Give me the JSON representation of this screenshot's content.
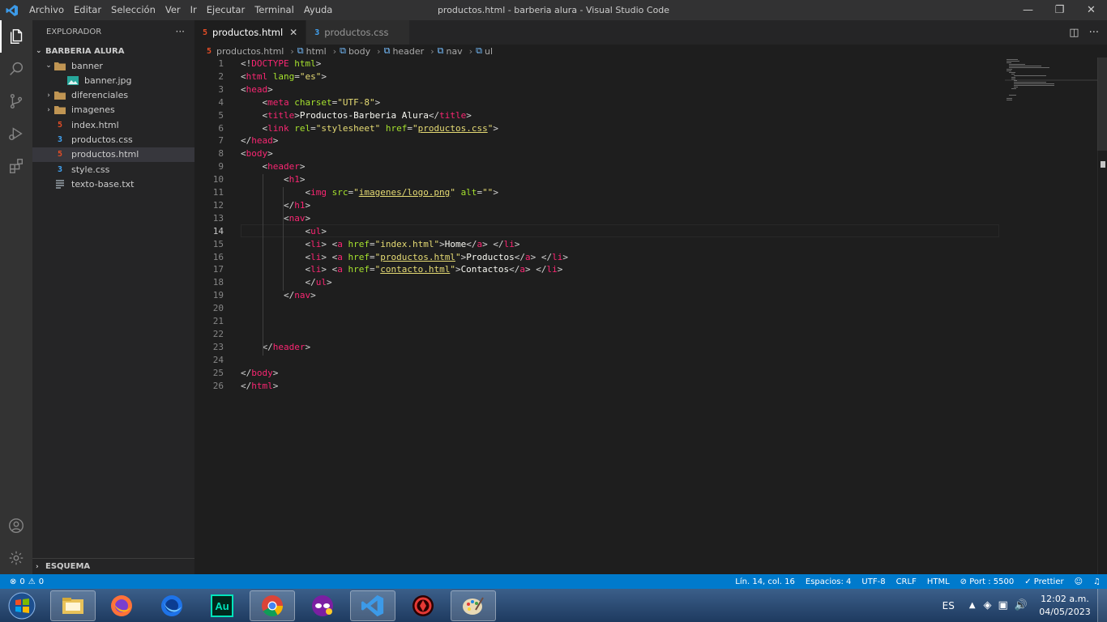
{
  "window": {
    "title": "productos.html - barberia alura - Visual Studio Code"
  },
  "menu": [
    "Archivo",
    "Editar",
    "Selección",
    "Ver",
    "Ir",
    "Ejecutar",
    "Terminal",
    "Ayuda"
  ],
  "sidebar": {
    "title": "EXPLORADOR",
    "more": "···",
    "workspace": "BARBERIA ALURA",
    "items": [
      {
        "label": "banner",
        "type": "folder-open",
        "depth": 1
      },
      {
        "label": "banner.jpg",
        "type": "image",
        "depth": 2
      },
      {
        "label": "diferenciales",
        "type": "folder",
        "depth": 1
      },
      {
        "label": "imagenes",
        "type": "folder",
        "depth": 1
      },
      {
        "label": "index.html",
        "type": "html",
        "depth": 1
      },
      {
        "label": "productos.css",
        "type": "css",
        "depth": 1
      },
      {
        "label": "productos.html",
        "type": "html",
        "depth": 1,
        "selected": true
      },
      {
        "label": "style.css",
        "type": "css",
        "depth": 1
      },
      {
        "label": "texto-base.txt",
        "type": "txt",
        "depth": 1
      }
    ],
    "outline": "ESQUEMA"
  },
  "tabs": [
    {
      "label": "productos.html",
      "type": "html",
      "active": true
    },
    {
      "label": "productos.css",
      "type": "css",
      "active": false
    }
  ],
  "breadcrumb": [
    "productos.html",
    "html",
    "body",
    "header",
    "nav",
    "ul"
  ],
  "editor": {
    "current_line": 14,
    "lines": [
      [
        [
          "t",
          "<!"
        ],
        [
          "tg",
          "DOCTYPE"
        ],
        [
          "t",
          " "
        ],
        [
          "at",
          "html"
        ],
        [
          "t",
          ">"
        ]
      ],
      [
        [
          "t",
          "<"
        ],
        [
          "tg",
          "html"
        ],
        [
          "t",
          " "
        ],
        [
          "at",
          "lang"
        ],
        [
          "t",
          "="
        ],
        [
          "st",
          "\"es\""
        ],
        [
          "t",
          ">"
        ]
      ],
      [
        [
          "t",
          "<"
        ],
        [
          "tg",
          "head"
        ],
        [
          "t",
          ">"
        ]
      ],
      [
        [
          "t",
          "    <"
        ],
        [
          "tg",
          "meta"
        ],
        [
          "t",
          " "
        ],
        [
          "at",
          "charset"
        ],
        [
          "t",
          "="
        ],
        [
          "st",
          "\"UTF-8\""
        ],
        [
          "t",
          ">"
        ]
      ],
      [
        [
          "t",
          "    <"
        ],
        [
          "tg",
          "title"
        ],
        [
          "t",
          ">"
        ],
        [
          "tx",
          "Productos-Barberia Alura"
        ],
        [
          "t",
          "</"
        ],
        [
          "tg",
          "title"
        ],
        [
          "t",
          ">"
        ]
      ],
      [
        [
          "t",
          "    <"
        ],
        [
          "tg",
          "link"
        ],
        [
          "t",
          " "
        ],
        [
          "at",
          "rel"
        ],
        [
          "t",
          "="
        ],
        [
          "st",
          "\"stylesheet\""
        ],
        [
          "t",
          " "
        ],
        [
          "at",
          "href"
        ],
        [
          "t",
          "="
        ],
        [
          "st",
          "\""
        ],
        [
          "stu",
          "productos.css"
        ],
        [
          "st",
          "\""
        ],
        [
          "t",
          ">"
        ]
      ],
      [
        [
          "t",
          "</"
        ],
        [
          "tg",
          "head"
        ],
        [
          "t",
          ">"
        ]
      ],
      [
        [
          "t",
          "<"
        ],
        [
          "tg",
          "body"
        ],
        [
          "t",
          ">"
        ]
      ],
      [
        [
          "t",
          "    <"
        ],
        [
          "tg",
          "header"
        ],
        [
          "t",
          ">"
        ]
      ],
      [
        [
          "t",
          "        <"
        ],
        [
          "tg",
          "h1"
        ],
        [
          "t",
          ">"
        ]
      ],
      [
        [
          "t",
          "            <"
        ],
        [
          "tg",
          "img"
        ],
        [
          "t",
          " "
        ],
        [
          "at",
          "src"
        ],
        [
          "t",
          "="
        ],
        [
          "st",
          "\""
        ],
        [
          "stu",
          "imagenes/logo.png"
        ],
        [
          "st",
          "\""
        ],
        [
          "t",
          " "
        ],
        [
          "at",
          "alt"
        ],
        [
          "t",
          "="
        ],
        [
          "st",
          "\"\""
        ],
        [
          "t",
          ">"
        ]
      ],
      [
        [
          "t",
          "        </"
        ],
        [
          "tg",
          "h1"
        ],
        [
          "t",
          ">"
        ]
      ],
      [
        [
          "t",
          "        <"
        ],
        [
          "tg",
          "nav"
        ],
        [
          "t",
          ">"
        ]
      ],
      [
        [
          "t",
          "            <"
        ],
        [
          "tg",
          "ul"
        ],
        [
          "t",
          ">"
        ]
      ],
      [
        [
          "t",
          "            <"
        ],
        [
          "tg",
          "li"
        ],
        [
          "t",
          "> <"
        ],
        [
          "tg",
          "a"
        ],
        [
          "t",
          " "
        ],
        [
          "at",
          "href"
        ],
        [
          "t",
          "="
        ],
        [
          "st",
          "\"index.html\""
        ],
        [
          "t",
          ">"
        ],
        [
          "tx",
          "Home"
        ],
        [
          "t",
          "</"
        ],
        [
          "tg",
          "a"
        ],
        [
          "t",
          "> </"
        ],
        [
          "tg",
          "li"
        ],
        [
          "t",
          ">"
        ]
      ],
      [
        [
          "t",
          "            <"
        ],
        [
          "tg",
          "li"
        ],
        [
          "t",
          "> <"
        ],
        [
          "tg",
          "a"
        ],
        [
          "t",
          " "
        ],
        [
          "at",
          "href"
        ],
        [
          "t",
          "="
        ],
        [
          "st",
          "\""
        ],
        [
          "stu",
          "productos.html"
        ],
        [
          "st",
          "\""
        ],
        [
          "t",
          ">"
        ],
        [
          "tx",
          "Productos"
        ],
        [
          "t",
          "</"
        ],
        [
          "tg",
          "a"
        ],
        [
          "t",
          "> </"
        ],
        [
          "tg",
          "li"
        ],
        [
          "t",
          ">"
        ]
      ],
      [
        [
          "t",
          "            <"
        ],
        [
          "tg",
          "li"
        ],
        [
          "t",
          "> <"
        ],
        [
          "tg",
          "a"
        ],
        [
          "t",
          " "
        ],
        [
          "at",
          "href"
        ],
        [
          "t",
          "="
        ],
        [
          "st",
          "\""
        ],
        [
          "stu",
          "contacto.html"
        ],
        [
          "st",
          "\""
        ],
        [
          "t",
          ">"
        ],
        [
          "tx",
          "Contactos"
        ],
        [
          "t",
          "</"
        ],
        [
          "tg",
          "a"
        ],
        [
          "t",
          "> </"
        ],
        [
          "tg",
          "li"
        ],
        [
          "t",
          ">"
        ]
      ],
      [
        [
          "t",
          "            </"
        ],
        [
          "tg",
          "ul"
        ],
        [
          "t",
          ">"
        ]
      ],
      [
        [
          "t",
          "        </"
        ],
        [
          "tg",
          "nav"
        ],
        [
          "t",
          ">"
        ]
      ],
      [],
      [],
      [],
      [
        [
          "t",
          "    </"
        ],
        [
          "tg",
          "header"
        ],
        [
          "t",
          ">"
        ]
      ],
      [],
      [
        [
          "t",
          "</"
        ],
        [
          "tg",
          "body"
        ],
        [
          "t",
          ">"
        ]
      ],
      [
        [
          "t",
          "</"
        ],
        [
          "tg",
          "html"
        ],
        [
          "t",
          ">"
        ]
      ]
    ]
  },
  "status": {
    "errors": "0",
    "warnings": "0",
    "position": "Lín. 14, col. 16",
    "spaces": "Espacios: 4",
    "encoding": "UTF-8",
    "eol": "CRLF",
    "language": "HTML",
    "port": "Port : 5500",
    "formatter": "Prettier"
  },
  "taskbar": {
    "apps": [
      "start",
      "explorer",
      "firefox",
      "firefox-dev",
      "audition",
      "chrome",
      "app-mask",
      "vscode",
      "app-red",
      "paint"
    ],
    "lang": "ES",
    "time": "12:02 a.m.",
    "date": "04/05/2023"
  },
  "colors": {
    "accent": "#007acc",
    "tag": "#f92672",
    "attr": "#a6e22e",
    "string": "#e6db74"
  }
}
